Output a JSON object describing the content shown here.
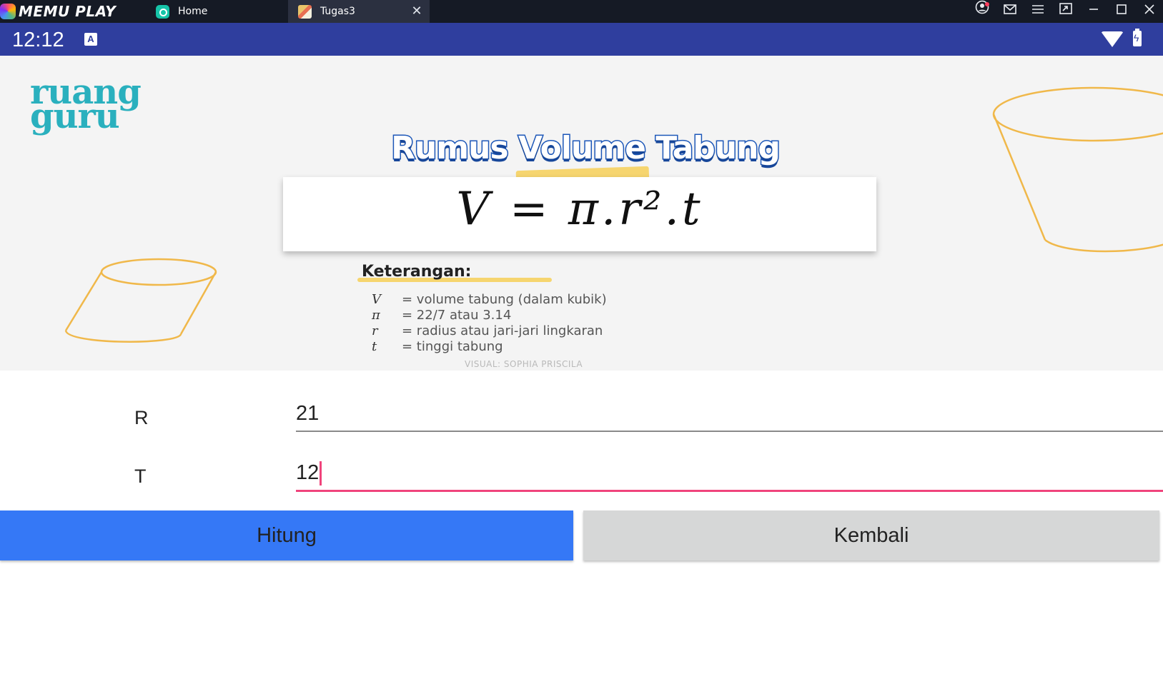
{
  "emulator": {
    "brand": "MEMU PLAY",
    "tabs": [
      {
        "label": "Home",
        "icon": "home-app-icon",
        "active": false
      },
      {
        "label": "Tugas3",
        "icon": "tugas3-app-icon",
        "active": true
      }
    ],
    "controls": [
      "account-icon",
      "mail-icon",
      "menu-icon",
      "screen-icon",
      "minimize-icon",
      "maximize-icon",
      "close-icon"
    ]
  },
  "statusbar": {
    "time": "12:12",
    "notification_icon": "A",
    "icons": [
      "wifi-icon",
      "battery-charging-icon"
    ]
  },
  "banner": {
    "brand": [
      "ruang",
      "guru"
    ],
    "headline": "Rumus Volume Tabung",
    "formula": "V = π.r².t",
    "keterangan_title": "Keterangan:",
    "keterangan": [
      {
        "symbol": "V",
        "text": "= volume tabung (dalam kubik)"
      },
      {
        "symbol": "π",
        "text": "= 22/7 atau 3.14"
      },
      {
        "symbol": "r",
        "text": "= radius atau jari-jari lingkaran"
      },
      {
        "symbol": "t",
        "text": "= tinggi tabung"
      }
    ],
    "credit": "VISUAL: SOPHIA PRISCILA",
    "colors": {
      "brand": "#2ab0be",
      "headline": "#1b56b8",
      "accent": "#f6d56f",
      "cylinder": "#f0b84a"
    }
  },
  "form": {
    "r_label": "R",
    "r_value": "21",
    "t_label": "T",
    "t_value": "12",
    "active_color": "#f0447c"
  },
  "buttons": {
    "hitung": "Hitung",
    "kembali": "Kembali",
    "hitung_color": "#3578f6",
    "kembali_color": "#d6d7d7"
  }
}
